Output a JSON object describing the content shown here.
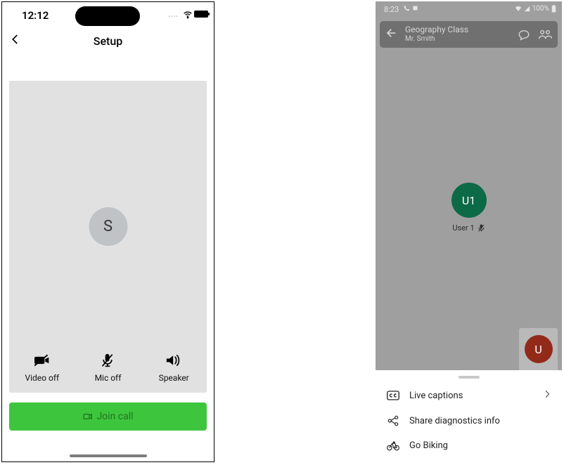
{
  "left": {
    "status": {
      "time": "12:12"
    },
    "nav": {
      "title": "Setup"
    },
    "avatar_initial": "S",
    "controls": {
      "video": "Video off",
      "mic": "Mic off",
      "speaker": "Speaker"
    },
    "join_label": "Join call"
  },
  "right": {
    "status": {
      "time": "8:23",
      "battery": "100%"
    },
    "header": {
      "title": "Geography Class",
      "subtitle": "Mr. Smith"
    },
    "participant": {
      "initials": "U1",
      "name": "User 1"
    },
    "fab_initial": "U",
    "menu": {
      "captions": "Live captions",
      "diagnostics": "Share diagnostics info",
      "biking": "Go Biking"
    }
  }
}
